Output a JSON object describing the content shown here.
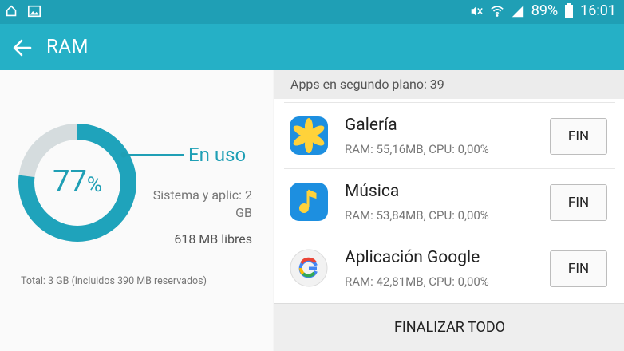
{
  "statusbar": {
    "battery": "89%",
    "time": "16:01",
    "icons": [
      "cloud-icon",
      "image-icon",
      "mute-icon",
      "wifi-icon",
      "signal-icon",
      "battery-icon"
    ]
  },
  "appbar": {
    "title": "RAM",
    "back_icon": "arrow-left-icon"
  },
  "ram": {
    "percent_used": 77,
    "percent_value": "77",
    "percent_sign": "%",
    "in_use_label": "En uso",
    "system_apps_label": "Sistema y aplic: 2 GB",
    "free_label": "618 MB libres",
    "total_label": "Total: 3 GB (incluidos 390 MB reservados)",
    "colors": {
      "used": "#1fa3bb",
      "free": "#d5dcde"
    }
  },
  "background_apps": {
    "header": "Apps en segundo plano: 39",
    "finish_label": "FIN",
    "finish_all_label": "FINALIZAR TODO",
    "items": [
      {
        "name": "Galería",
        "stats": "RAM: 55,16MB, CPU: 0,00%",
        "icon": "gallery-icon"
      },
      {
        "name": "Música",
        "stats": "RAM: 53,84MB, CPU: 0,00%",
        "icon": "music-icon"
      },
      {
        "name": "Aplicación Google",
        "stats": "RAM: 42,81MB, CPU: 0,00%",
        "icon": "google-icon"
      }
    ]
  },
  "colors": {
    "statusbar": "#1f9fb5",
    "appbar": "#25b0c6",
    "accent": "#1f9fb5"
  }
}
